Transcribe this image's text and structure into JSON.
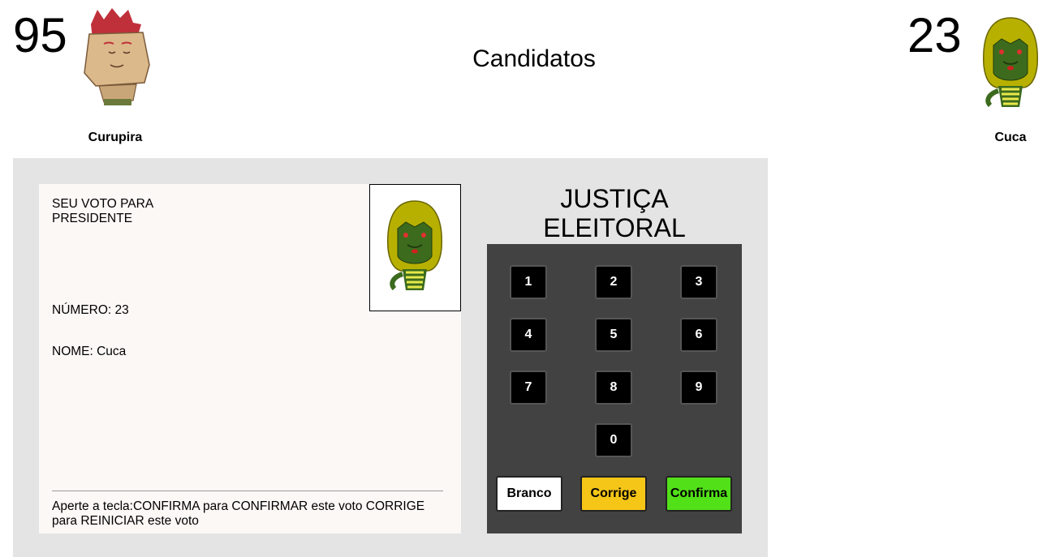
{
  "header": {
    "title": "Candidatos"
  },
  "candidates": [
    {
      "number": "95",
      "name": "Curupira"
    },
    {
      "number": "23",
      "name": "Cuca"
    }
  ],
  "screen": {
    "vote_for_line1": "SEU VOTO PARA",
    "vote_for_line2": "PRESIDENTE",
    "number_text": "NÚMERO: 23",
    "name_text": "NOME: Cuca",
    "instructions": "Aperte a tecla:CONFIRMA para CONFIRMAR este voto CORRIGE para REINICIAR este voto"
  },
  "brand": {
    "line1": "JUSTIÇA",
    "line2": "ELEITORAL"
  },
  "keypad": {
    "digits": [
      "1",
      "2",
      "3",
      "4",
      "5",
      "6",
      "7",
      "8",
      "9",
      "0"
    ],
    "branco": "Branco",
    "corrige": "Corrige",
    "confirma": "Confirma"
  },
  "colors": {
    "branco": "#ffffff",
    "corrige": "#f5c518",
    "confirma": "#52e019",
    "urna_bg": "#e4e4e4",
    "keypad_bg": "#424242"
  }
}
